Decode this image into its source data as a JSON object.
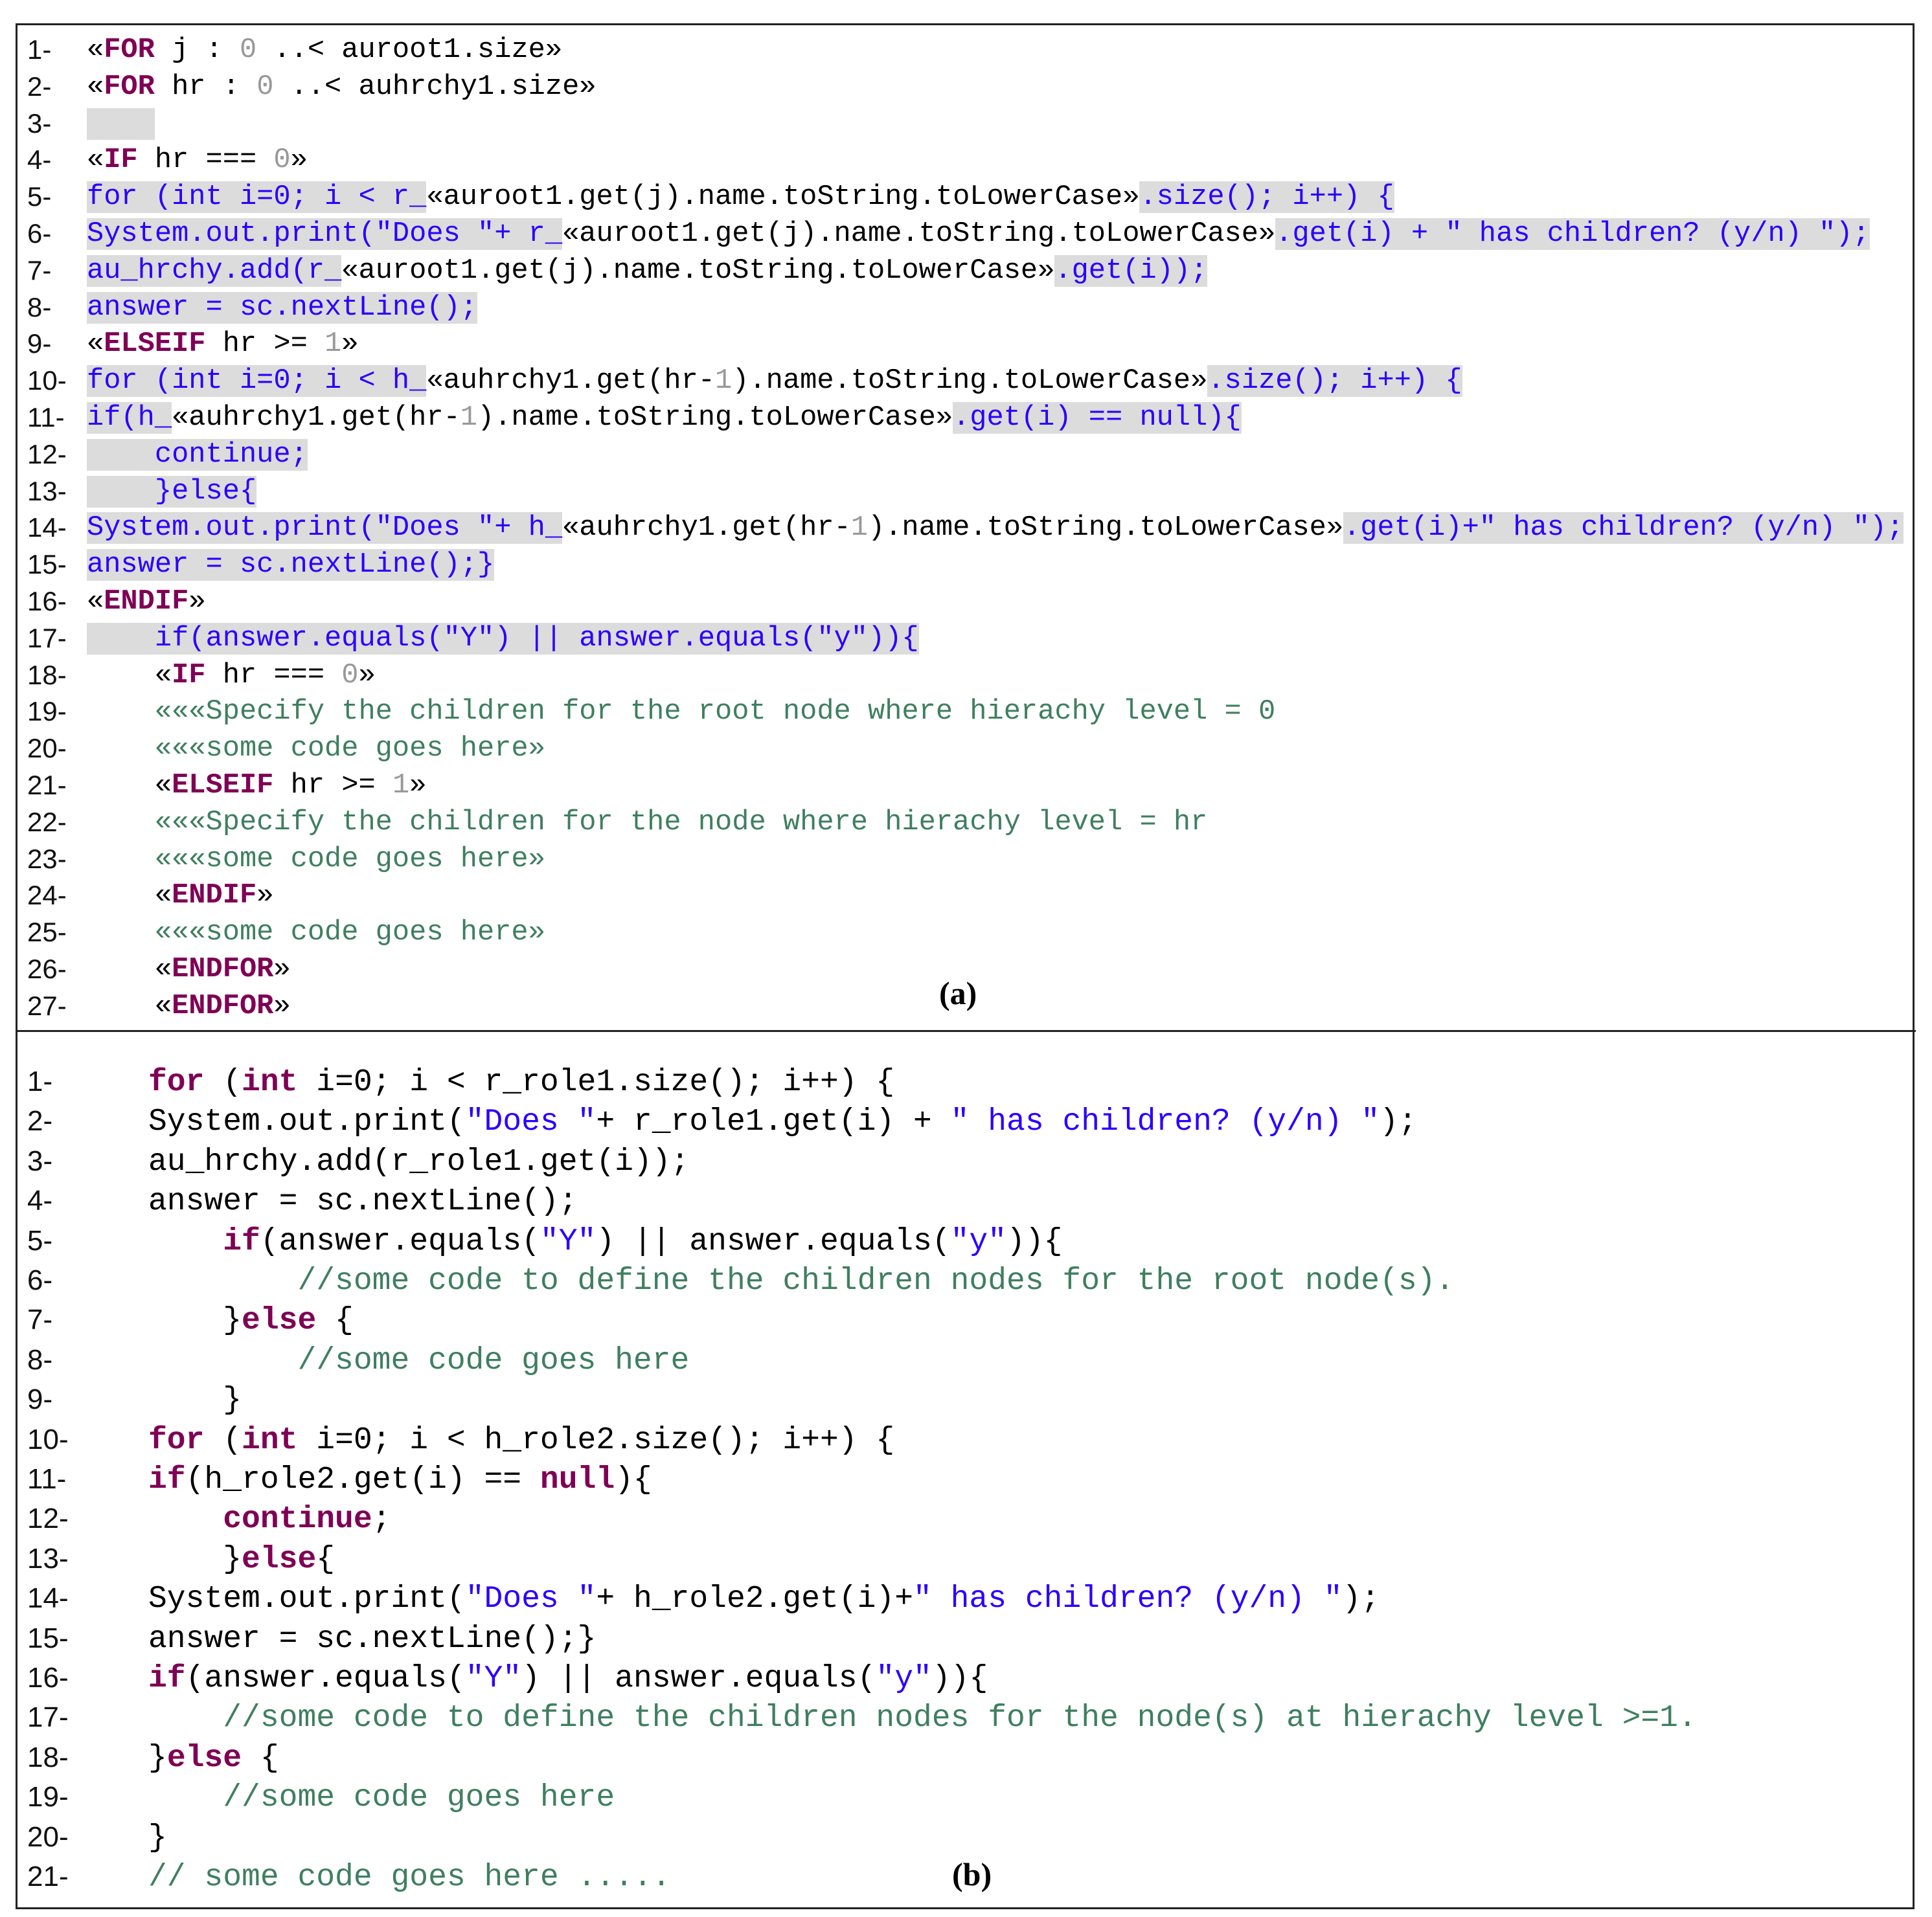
{
  "panel_a": {
    "caption": "(a)",
    "lines": [
      {
        "n": "1-",
        "s": [
          [
            "",
            "«"
          ],
          [
            "k",
            "FOR"
          ],
          [
            "",
            " j : "
          ],
          [
            "g",
            "0"
          ],
          [
            "",
            " ..< auroot1.size»"
          ]
        ]
      },
      {
        "n": "2-",
        "s": [
          [
            "",
            "«"
          ],
          [
            "k",
            "FOR"
          ],
          [
            "",
            " hr : "
          ],
          [
            "g",
            "0"
          ],
          [
            "",
            " ..< auhrchy1.size»"
          ]
        ]
      },
      {
        "n": "3-",
        "s": [
          [
            "b h",
            "    "
          ]
        ]
      },
      {
        "n": "4-",
        "s": [
          [
            "",
            "«"
          ],
          [
            "k",
            "IF"
          ],
          [
            "",
            " hr === "
          ],
          [
            "g",
            "0"
          ],
          [
            "",
            "»"
          ]
        ]
      },
      {
        "n": "5-",
        "s": [
          [
            "b h",
            "for (int i=0; i < r_"
          ],
          [
            "",
            "«auroot1.get(j).name.toString.toLowerCase»"
          ],
          [
            "b h",
            ".size(); i++) {"
          ]
        ]
      },
      {
        "n": "6-",
        "s": [
          [
            "b h",
            "System.out.print(\"Does \"+ r_"
          ],
          [
            "",
            "«auroot1.get(j).name.toString.toLowerCase»"
          ],
          [
            "b h",
            ".get(i) + \" has children? (y/n) \");"
          ]
        ]
      },
      {
        "n": "7-",
        "s": [
          [
            "b h",
            "au_hrchy.add(r_"
          ],
          [
            "",
            "«auroot1.get(j).name.toString.toLowerCase»"
          ],
          [
            "b h",
            ".get(i));"
          ]
        ]
      },
      {
        "n": "8-",
        "s": [
          [
            "b h",
            "answer = sc.nextLine();"
          ]
        ]
      },
      {
        "n": "9-",
        "s": [
          [
            "",
            "«"
          ],
          [
            "k",
            "ELSEIF"
          ],
          [
            "",
            " hr >= "
          ],
          [
            "g",
            "1"
          ],
          [
            "",
            "»"
          ]
        ]
      },
      {
        "n": "10-",
        "s": [
          [
            "b h",
            "for (int i=0; i < h_"
          ],
          [
            "",
            "«auhrchy1.get(hr-"
          ],
          [
            "g",
            "1"
          ],
          [
            "",
            ").name.toString.toLowerCase»"
          ],
          [
            "b h",
            ".size(); i++) {"
          ]
        ]
      },
      {
        "n": "11-",
        "s": [
          [
            "b h",
            "if(h_"
          ],
          [
            "",
            "«auhrchy1.get(hr-"
          ],
          [
            "g",
            "1"
          ],
          [
            "",
            ").name.toString.toLowerCase»"
          ],
          [
            "b h",
            ".get(i) == null){"
          ]
        ]
      },
      {
        "n": "12-",
        "s": [
          [
            "b h",
            "    continue;"
          ]
        ]
      },
      {
        "n": "13-",
        "s": [
          [
            "b h",
            "    }else{"
          ]
        ]
      },
      {
        "n": "14-",
        "s": [
          [
            "b h",
            "System.out.print(\"Does \"+ h_"
          ],
          [
            "",
            "«auhrchy1.get(hr-"
          ],
          [
            "g",
            "1"
          ],
          [
            "",
            ").name.toString.toLowerCase»"
          ],
          [
            "b h",
            ".get(i)+\" has children? (y/n) \");"
          ]
        ]
      },
      {
        "n": "15-",
        "s": [
          [
            "b h",
            "answer = sc.nextLine();}"
          ]
        ]
      },
      {
        "n": "16-",
        "s": [
          [
            "",
            "«"
          ],
          [
            "k",
            "ENDIF"
          ],
          [
            "",
            "»"
          ]
        ]
      },
      {
        "n": "17-",
        "s": [
          [
            "b h",
            "    if(answer.equals(\"Y\") || answer.equals(\"y\")){"
          ]
        ]
      },
      {
        "n": "18-",
        "s": [
          [
            "",
            "    «"
          ],
          [
            "k",
            "IF"
          ],
          [
            "",
            " hr === "
          ],
          [
            "g",
            "0"
          ],
          [
            "",
            "»"
          ]
        ]
      },
      {
        "n": "19-",
        "s": [
          [
            "c",
            "    «««Specify the children for the root node where hierachy level = 0"
          ]
        ]
      },
      {
        "n": "20-",
        "s": [
          [
            "c",
            "    «««some code goes here»"
          ]
        ]
      },
      {
        "n": "21-",
        "s": [
          [
            "",
            "    «"
          ],
          [
            "k",
            "ELSEIF"
          ],
          [
            "",
            " hr >= "
          ],
          [
            "g",
            "1"
          ],
          [
            "",
            "»"
          ]
        ]
      },
      {
        "n": "22-",
        "s": [
          [
            "c",
            "    «««Specify the children for the node where hierachy level = hr"
          ]
        ]
      },
      {
        "n": "23-",
        "s": [
          [
            "c",
            "    «««some code goes here»"
          ]
        ]
      },
      {
        "n": "24-",
        "s": [
          [
            "",
            "    «"
          ],
          [
            "k",
            "ENDIF"
          ],
          [
            "",
            "»"
          ]
        ]
      },
      {
        "n": "25-",
        "s": [
          [
            "c",
            "    «««some code goes here»"
          ]
        ]
      },
      {
        "n": "26-",
        "s": [
          [
            "",
            "    «"
          ],
          [
            "k",
            "ENDFOR"
          ],
          [
            "",
            "»"
          ]
        ]
      },
      {
        "n": "27-",
        "s": [
          [
            "",
            "    «"
          ],
          [
            "k",
            "ENDFOR"
          ],
          [
            "",
            "»"
          ]
        ]
      }
    ]
  },
  "panel_b": {
    "caption": "(b)",
    "lines": [
      {
        "n": "1-",
        "s": [
          [
            "k",
            "for"
          ],
          [
            "",
            " ("
          ],
          [
            "k",
            "int"
          ],
          [
            "",
            " i=0; i < r_role1.size(); i++) {"
          ]
        ]
      },
      {
        "n": "2-",
        "s": [
          [
            "",
            "System.out.print("
          ],
          [
            "s",
            "\"Does \""
          ],
          [
            "",
            "+ r_role1.get(i) + "
          ],
          [
            "s",
            "\" has children? (y/n) \""
          ],
          [
            "",
            ");"
          ]
        ]
      },
      {
        "n": "3-",
        "s": [
          [
            "",
            "au_hrchy.add(r_role1.get(i));"
          ]
        ]
      },
      {
        "n": "4-",
        "s": [
          [
            "",
            "answer = sc.nextLine();"
          ]
        ]
      },
      {
        "n": "5-",
        "s": [
          [
            "",
            "    "
          ],
          [
            "k",
            "if"
          ],
          [
            "",
            "(answer.equals("
          ],
          [
            "s",
            "\"Y\""
          ],
          [
            "",
            ") || answer.equals("
          ],
          [
            "s",
            "\"y\""
          ],
          [
            "",
            ")){"
          ]
        ]
      },
      {
        "n": "6-",
        "s": [
          [
            "c",
            "        //some code to define the children nodes for the root node(s)."
          ]
        ]
      },
      {
        "n": "7-",
        "s": [
          [
            "",
            "    }"
          ],
          [
            "k",
            "else"
          ],
          [
            "",
            " {"
          ]
        ]
      },
      {
        "n": "8-",
        "s": [
          [
            "c",
            "        //some code goes here"
          ]
        ]
      },
      {
        "n": "9-",
        "s": [
          [
            "",
            "    }"
          ]
        ]
      },
      {
        "n": "10-",
        "s": [
          [
            "k",
            "for"
          ],
          [
            "",
            " ("
          ],
          [
            "k",
            "int"
          ],
          [
            "",
            " i=0; i < h_role2.size(); i++) {"
          ]
        ]
      },
      {
        "n": "11-",
        "s": [
          [
            "k",
            "if"
          ],
          [
            "",
            "(h_role2.get(i) == "
          ],
          [
            "k",
            "null"
          ],
          [
            "",
            "){"
          ]
        ]
      },
      {
        "n": "12-",
        "s": [
          [
            "",
            "    "
          ],
          [
            "k",
            "continue"
          ],
          [
            "",
            ";"
          ]
        ]
      },
      {
        "n": "13-",
        "s": [
          [
            "",
            "    }"
          ],
          [
            "k",
            "else"
          ],
          [
            "",
            "{"
          ]
        ]
      },
      {
        "n": "14-",
        "s": [
          [
            "",
            "System.out.print("
          ],
          [
            "s",
            "\"Does \""
          ],
          [
            "",
            "+ h_role2.get(i)+"
          ],
          [
            "s",
            "\" has children? (y/n) \""
          ],
          [
            "",
            ");"
          ]
        ]
      },
      {
        "n": "15-",
        "s": [
          [
            "",
            "answer = sc.nextLine();}"
          ]
        ]
      },
      {
        "n": "16-",
        "s": [
          [
            "k",
            "if"
          ],
          [
            "",
            "(answer.equals("
          ],
          [
            "s",
            "\"Y\""
          ],
          [
            "",
            ") || answer.equals("
          ],
          [
            "s",
            "\"y\""
          ],
          [
            "",
            ")){"
          ]
        ]
      },
      {
        "n": "17-",
        "s": [
          [
            "c",
            "    //some code to define the children nodes for the node(s) at hierachy level >=1."
          ]
        ]
      },
      {
        "n": "18-",
        "s": [
          [
            "",
            "}"
          ],
          [
            "k",
            "else"
          ],
          [
            "",
            " {"
          ]
        ]
      },
      {
        "n": "19-",
        "s": [
          [
            "c",
            "    //some code goes here"
          ]
        ]
      },
      {
        "n": "20-",
        "s": [
          [
            "",
            "}"
          ]
        ]
      },
      {
        "n": "21-",
        "s": [
          [
            "c",
            "// some code goes here ....."
          ]
        ]
      }
    ]
  }
}
